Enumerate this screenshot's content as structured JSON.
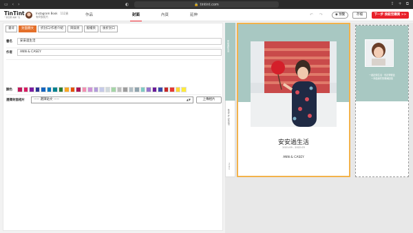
{
  "browser": {
    "url": "tintint.com"
  },
  "app": {
    "logo": "TinTint",
    "logo_sub": "一鍵出書 美麗一生",
    "account_name": "Instagram Book",
    "account_count": "112頁",
    "account_sub": "有9張照片",
    "nav": {
      "works": "作品",
      "cover": "封面",
      "content": "內頁",
      "extra": "延伸"
    },
    "preview_label": "預覽",
    "save_label": "存檔",
    "next_label": "下一步 按鈕至購買 >>"
  },
  "tabs": [
    "書背",
    "封面圖文",
    "折封口/作者介紹",
    "目錄頁",
    "版權頁",
    "後折封口"
  ],
  "form": {
    "title_label": "書名",
    "title_value": "安安過生活",
    "author_label": "作者",
    "author_value": "ANN & CASEY",
    "color_label": "顏色",
    "photo_label": "選擇封面相片",
    "photo_select": "----- 選擇貼文 -----",
    "upload_label": "上傳相片"
  },
  "colors": {
    "accent": "#e8202a",
    "tab_active": "#e46f2a",
    "cover_bg": "#a8c8c2",
    "highlight": "#f3b24a",
    "swatches": [
      "#c2185b",
      "#d81b60",
      "#7b1fa2",
      "#283593",
      "#1565c0",
      "#0277bd",
      "#00838f",
      "#2e7d32",
      "#f9a825",
      "#e65100",
      "#ad1457",
      "#f48fb1",
      "#ce93d8",
      "#b39ddb",
      "#c5cae9",
      "#cfd8dc",
      "#a5d6a7",
      "#bdbdbd",
      "#9e9e9e",
      "#b0bec5",
      "#90a4ae",
      "#80cbc4",
      "#9575cd",
      "#6a1b9a",
      "#3949ab",
      "#c62828",
      "#e53935",
      "#fdd835",
      "#ffeb3b"
    ]
  },
  "book": {
    "title": "安安過生活",
    "dates": "2021.09 - 2022.03",
    "authors": "ANN & CASEY",
    "spine_title": "安安過生活",
    "spine_author": "ANN & CASEY",
    "spine_logo": "TinTint",
    "back_text_1": "一起記錄生活 · 也記得彼此",
    "back_text_2": "一本給我們的專屬回憶"
  }
}
